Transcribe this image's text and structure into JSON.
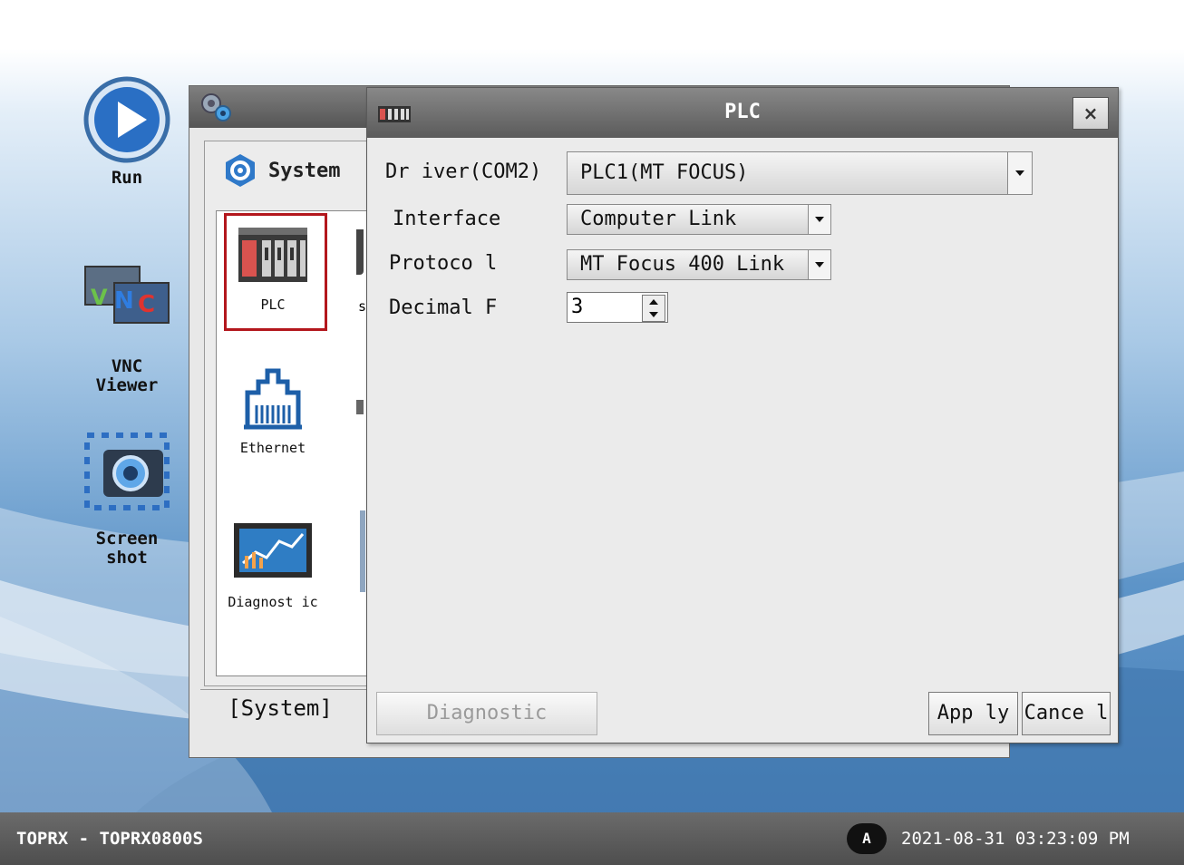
{
  "dock": {
    "run_label": "Run",
    "vnc_label": "VNC\nViewer",
    "screenshot_label": "Screen\nshot"
  },
  "system_window": {
    "header_label": "System",
    "footer_label": "[System]",
    "items": [
      {
        "label": "PLC",
        "icon": "plc-icon",
        "selected": true
      },
      {
        "label": "Ethernet",
        "icon": "ethernet-icon"
      },
      {
        "label": "Diagnost ic",
        "icon": "diagnostic-icon"
      }
    ],
    "partial_label": "s"
  },
  "dialog": {
    "title": "PLC",
    "driver_label": "Dr iver(COM2)",
    "driver_value": "PLC1(MT FOCUS)",
    "interface_label": "Interface",
    "interface_value": "Computer Link",
    "protocol_label": "Protoco l",
    "protocol_value": "MT Focus 400 Link",
    "decimal_label": "Decimal F",
    "decimal_value": "3",
    "diagnostic_button": "Diagnostic",
    "apply_button": "App ly",
    "cancel_button": "Cance l",
    "close_glyph": "×"
  },
  "statusbar": {
    "device": "TOPRX - TOPRX0800S",
    "badge": "A",
    "datetime": "2021-08-31 03:23:09 PM"
  },
  "colors": {
    "selection_border": "#b3171d",
    "titlebar": "#6b6b6b",
    "desktop_blue": "#5d94c8"
  }
}
